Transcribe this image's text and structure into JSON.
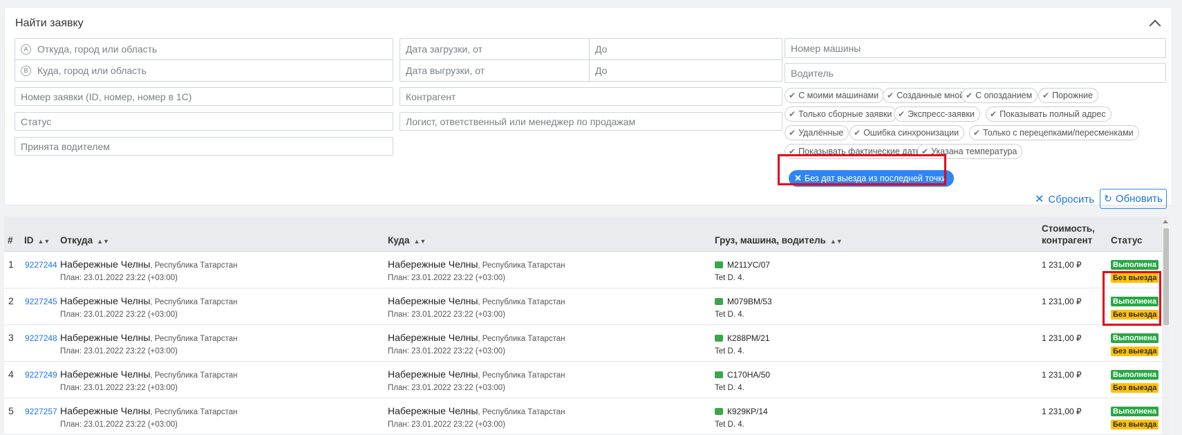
{
  "search_panel": {
    "title": "Найти заявку",
    "from_circle": "A",
    "to_circle": "B",
    "from_placeholder": "Откуда, город или область",
    "to_placeholder": "Куда, город или область",
    "load_date_from": "Дата загрузки, от",
    "load_date_to": "До",
    "unload_date_from": "Дата выгрузки, от",
    "unload_date_to": "До",
    "vehicle_number": "Номер машины",
    "driver": "Водитель",
    "order_number": "Номер заявки (ID, номер, номер в 1С)",
    "counterparty": "Контрагент",
    "status": "Статус",
    "logist": "Логист, ответственный или менеджер по продажам",
    "accepted_by_driver": "Принята водителем",
    "filter_chips": [
      "С моими машинами",
      "Созданные мной",
      "С опозданием",
      "Порожние",
      "Только сборные заявки",
      "Экспресс-заявки",
      "Показывать полный адрес",
      "Удалённые",
      "Ошибка синхронизации",
      "Только с перецепками/пересменками",
      "Показывать фактические даты",
      "Указана температура"
    ],
    "active_chip": "Без дат выезда из последней точки",
    "reset_label": "Сбросить",
    "refresh_label": "Обновить"
  },
  "table": {
    "headers": {
      "num": "#",
      "id": "ID",
      "from": "Откуда",
      "to": "Куда",
      "cargo": "Груз, машина, водитель",
      "cost_line1": "Стоимость,",
      "cost_line2": "контрагент",
      "status": "Статус"
    },
    "rows": [
      {
        "num": "1",
        "id": "9227244",
        "from_city": "Набережные Челны",
        "from_region": ", Республика Татарстан",
        "from_plan": "План: 23.01.2022 23:22 (+03:00)",
        "to_city": "Набережные Челны",
        "to_region": ", Республика Татарстан",
        "to_plan": "План: 23.01.2022 23:22 (+03:00)",
        "plate": "М211УС/07",
        "driver": "Tet D. 4.",
        "price": "1 231,00 ₽",
        "status": "Выполнена",
        "extra_status": "Без выезда"
      },
      {
        "num": "2",
        "id": "9227245",
        "from_city": "Набережные Челны",
        "from_region": ", Республика Татарстан",
        "from_plan": "План: 23.01.2022 23:22 (+03:00)",
        "to_city": "Набережные Челны",
        "to_region": ", Республика Татарстан",
        "to_plan": "План: 23.01.2022 23:22 (+03:00)",
        "plate": "М079ВМ/53",
        "driver": "Tet D. 4.",
        "price": "1 231,00 ₽",
        "status": "Выполнена",
        "extra_status": "Без выезда"
      },
      {
        "num": "3",
        "id": "9227248",
        "from_city": "Набережные Челны",
        "from_region": ", Республика Татарстан",
        "from_plan": "План: 23.01.2022 23:22 (+03:00)",
        "to_city": "Набережные Челны",
        "to_region": ", Республика Татарстан",
        "to_plan": "План: 23.01.2022 23:22 (+03:00)",
        "plate": "К288РМ/21",
        "driver": "Tet D. 4.",
        "price": "1 231,00 ₽",
        "status": "Выполнена",
        "extra_status": "Без выезда"
      },
      {
        "num": "4",
        "id": "9227249",
        "from_city": "Набережные Челны",
        "from_region": ", Республика Татарстан",
        "from_plan": "План: 23.01.2022 23:22 (+03:00)",
        "to_city": "Набережные Челны",
        "to_region": ", Республика Татарстан",
        "to_plan": "План: 23.01.2022 23:22 (+03:00)",
        "plate": "С170НА/50",
        "driver": "Tet D. 4.",
        "price": "1 231,00 ₽",
        "status": "Выполнена",
        "extra_status": "Без выезда"
      },
      {
        "num": "5",
        "id": "9227257",
        "from_city": "Набережные Челны",
        "from_region": ", Республика Татарстан",
        "from_plan": "План: 23.01.2022 23:22 (+03:00)",
        "to_city": "Набережные Челны",
        "to_region": ", Республика Татарстан",
        "to_plan": "План: 23.01.2022 23:22 (+03:00)",
        "plate": "К929КР/14",
        "driver": "Tet D. 4.",
        "price": "1 231,00 ₽",
        "status": "Выполнена",
        "extra_status": "Без выезда"
      }
    ]
  },
  "colors": {
    "accent": "#2f86f2",
    "status_done": "#28a745",
    "status_no_departure": "#ffc107",
    "highlight": "#e3001b"
  }
}
